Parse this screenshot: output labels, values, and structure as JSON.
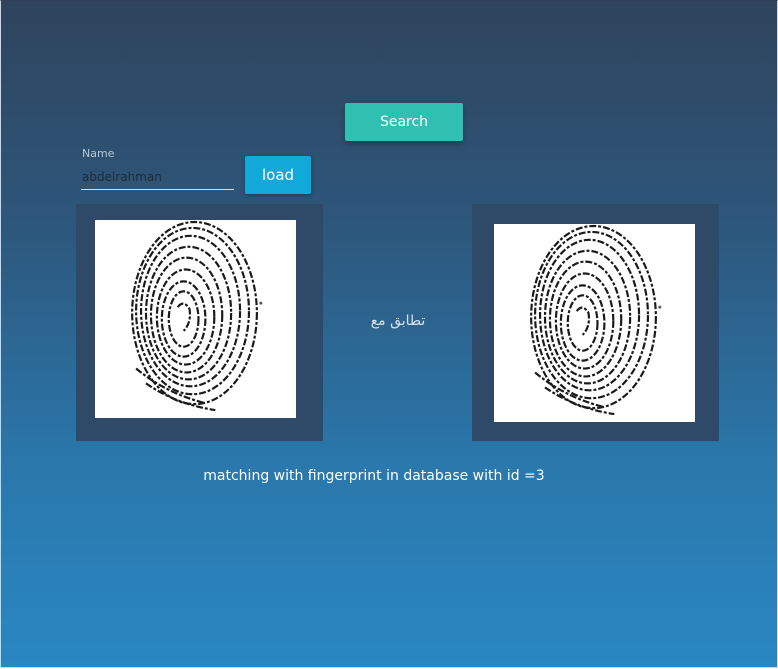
{
  "search_button": {
    "label": "Search",
    "color": "#2fc0b2"
  },
  "name_field": {
    "label": "Name",
    "value": "abdelrahman"
  },
  "load_button": {
    "label": "load",
    "color": "#11a9d9"
  },
  "match_label": "تطابق مع",
  "result_message": "matching with fingerprint in database with id =3",
  "images": {
    "input_fingerprint": "fingerprint-image",
    "matched_fingerprint": "fingerprint-image"
  },
  "colors": {
    "background_top": "#2f435c",
    "background_bottom": "#2a87c2",
    "panel": "#2f4a68"
  }
}
